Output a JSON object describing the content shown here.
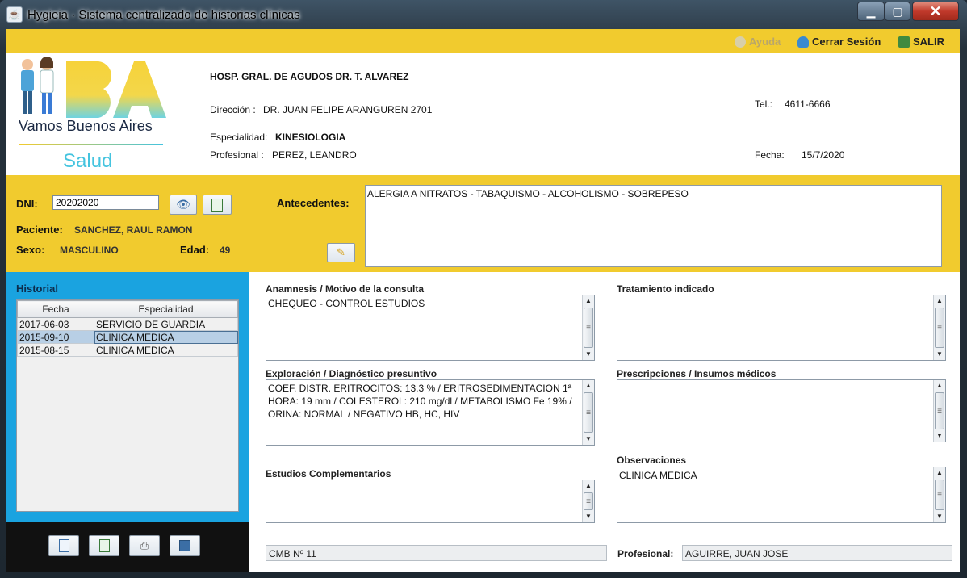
{
  "window": {
    "title": "Hygieia · Sistema centralizado de historias clínicas"
  },
  "topbar": {
    "help": "Ayuda",
    "logout": "Cerrar Sesión",
    "exit": "SALIR"
  },
  "logo": {
    "main": "Vamos Buenos Aires",
    "sub": "Salud",
    "mark": "BA"
  },
  "header": {
    "hospital": "HOSP. GRAL. DE AGUDOS DR. T. ALVAREZ",
    "address_label": "Dirección :",
    "address": "DR. JUAN FELIPE ARANGUREN 2701",
    "tel_label": "Tel.:",
    "tel": "4611-6666",
    "specialty_label": "Especialidad:",
    "specialty": "KINESIOLOGIA",
    "professional_label": "Profesional :",
    "professional": "PEREZ, LEANDRO",
    "date_label": "Fecha:",
    "date": "15/7/2020"
  },
  "patient": {
    "dni_label": "DNI:",
    "dni": "20202020",
    "name_label": "Paciente:",
    "name": "SANCHEZ, RAUL RAMON",
    "sex_label": "Sexo:",
    "sex": "MASCULINO",
    "age_label": "Edad:",
    "age": "49",
    "background_label": "Antecedentes:",
    "background": "ALERGIA A NITRATOS - TABAQUISMO - ALCOHOLISMO - SOBREPESO"
  },
  "history": {
    "title": "Historial",
    "columns": [
      "Fecha",
      "Especialidad"
    ],
    "rows": [
      {
        "date": "2017-06-03",
        "specialty": "SERVICIO DE GUARDIA"
      },
      {
        "date": "2015-09-10",
        "specialty": "CLINICA MEDICA"
      },
      {
        "date": "2015-08-15",
        "specialty": "CLINICA MEDICA"
      }
    ]
  },
  "consult": {
    "anamnesis_label": "Anamnesis / Motivo de la consulta",
    "anamnesis": "CHEQUEO - CONTROL ESTUDIOS",
    "treatment_label": "Tratamiento indicado",
    "treatment": "",
    "exploration_label": "Exploración / Diagnóstico presuntivo",
    "exploration": "COEF. DISTR. ERITROCITOS: 13.3 % / ERITROSEDIMENTACION 1ª HORA: 19 mm / COLESTEROL: 210 mg/dl / METABOLISMO Fe 19% / ORINA: NORMAL / NEGATIVO HB, HC, HIV",
    "prescriptions_label": "Prescripciones / Insumos médicos",
    "prescriptions": "",
    "studies_label": "Estudios Complementarios",
    "studies": "",
    "observations_label": "Observaciones",
    "observations": "CLINICA MEDICA",
    "cmb": "CMB Nº 11",
    "professional_label": "Profesional:",
    "professional": "AGUIRRE, JUAN JOSE"
  }
}
